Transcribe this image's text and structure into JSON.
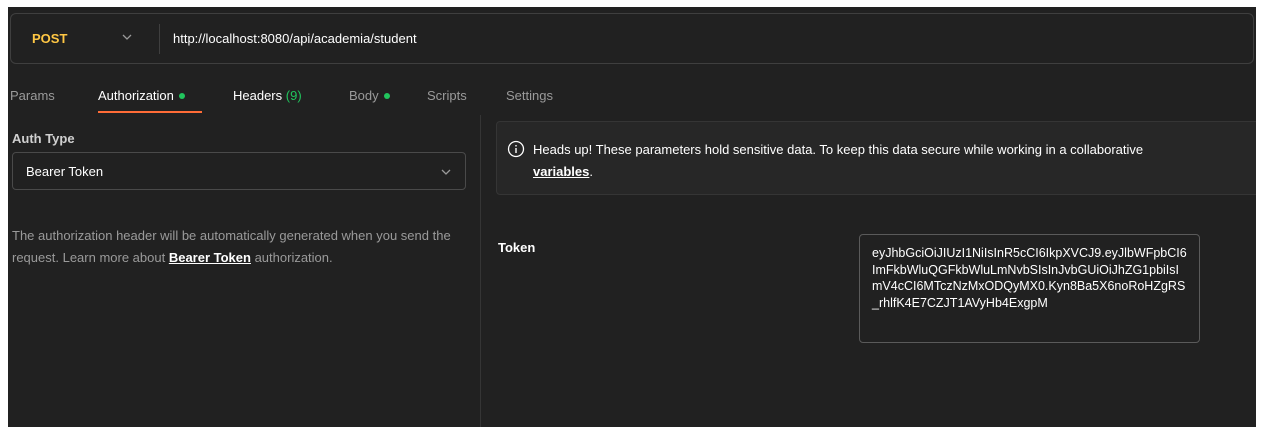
{
  "request": {
    "method": "POST",
    "url": "http://localhost:8080/api/academia/student"
  },
  "tabs": [
    {
      "label": "Params"
    },
    {
      "label": "Authorization",
      "active": true,
      "dot": true
    },
    {
      "label": "Headers",
      "count": "(9)"
    },
    {
      "label": "Body",
      "dot": true
    },
    {
      "label": "Scripts"
    },
    {
      "label": "Settings"
    }
  ],
  "auth": {
    "type_label": "Auth Type",
    "type_value": "Bearer Token",
    "desc_prefix": "The authorization header will be automatically generated when you send the request. Learn more about ",
    "desc_link": "Bearer Token",
    "desc_suffix": " authorization."
  },
  "notice": {
    "text": "Heads up! These parameters hold sensitive data. To keep this data secure while working in a collaborative",
    "link": "variables",
    "link_suffix": "."
  },
  "token": {
    "label": "Token",
    "value": "eyJhbGciOiJIUzI1NiIsInR5cCI6IkpXVCJ9.eyJlbWFpbCI6ImFkbWluQGFkbWluLmNvbSIsInJvbGUiOiJhZG1pbiIsImV4cCI6MTczNzMxODQyMX0.Kyn8Ba5X6noRoHZgRS_rhlfK4E7CZJT1AVyHb4ExgpM"
  },
  "colors": {
    "accent": "#ff6c37",
    "method": "#ffc744",
    "success": "#21c55d"
  },
  "icons": {
    "method_dropdown": "chevron-down-icon",
    "auth_dropdown": "chevron-down-icon",
    "notice": "info-circle-icon"
  }
}
